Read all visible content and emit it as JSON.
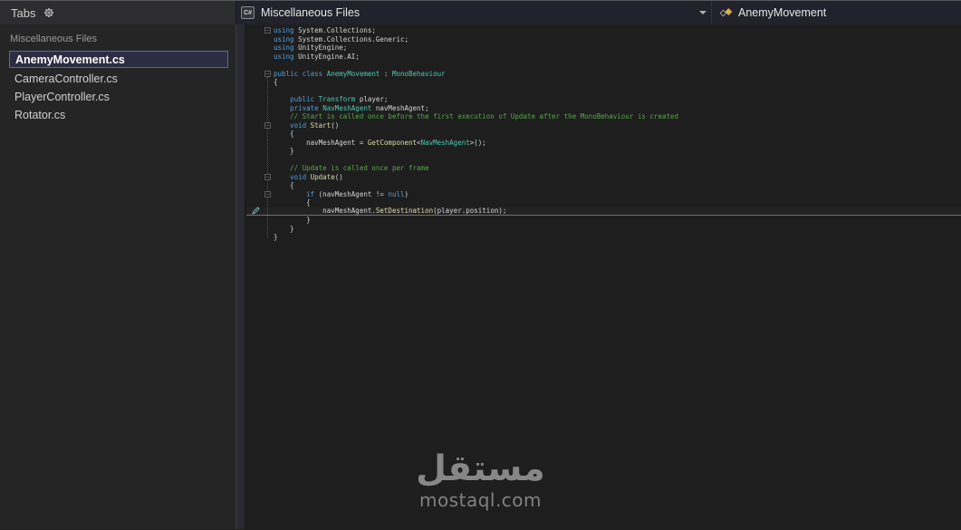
{
  "panel": {
    "title": "Tabs"
  },
  "sidebar": {
    "group_label": "Miscellaneous Files",
    "items": [
      {
        "label": "AnemyMovement.cs",
        "selected": true
      },
      {
        "label": "CameraController.cs",
        "selected": false
      },
      {
        "label": "PlayerController.cs",
        "selected": false
      },
      {
        "label": "Rotator.cs",
        "selected": false
      }
    ]
  },
  "editor_bar": {
    "file_icon_label": "C#",
    "project_label": "Miscellaneous Files",
    "symbol_label": "AnemyMovement"
  },
  "editor": {
    "current_line_index": 21,
    "lines": [
      {
        "fold": true,
        "tokens": [
          {
            "c": "kw",
            "t": "using"
          },
          {
            "c": "pl",
            "t": " System.Collections;"
          }
        ]
      },
      {
        "fold": false,
        "tokens": [
          {
            "c": "kw",
            "t": "using"
          },
          {
            "c": "pl",
            "t": " System.Collections.Generic;"
          }
        ]
      },
      {
        "fold": false,
        "tokens": [
          {
            "c": "kw",
            "t": "using"
          },
          {
            "c": "pl",
            "t": " UnityEngine;"
          }
        ]
      },
      {
        "fold": false,
        "tokens": [
          {
            "c": "kw",
            "t": "using"
          },
          {
            "c": "pl",
            "t": " UnityEngine.AI;"
          }
        ]
      },
      {
        "fold": false,
        "tokens": []
      },
      {
        "fold": true,
        "tokens": [
          {
            "c": "kw",
            "t": "public"
          },
          {
            "c": "pl",
            "t": " "
          },
          {
            "c": "kw",
            "t": "class"
          },
          {
            "c": "pl",
            "t": " "
          },
          {
            "c": "ty",
            "t": "AnemyMovement"
          },
          {
            "c": "pl",
            "t": " : "
          },
          {
            "c": "ty",
            "t": "MonoBehaviour"
          }
        ]
      },
      {
        "fold": false,
        "tokens": [
          {
            "c": "pl",
            "t": "{"
          }
        ]
      },
      {
        "fold": false,
        "tokens": []
      },
      {
        "fold": false,
        "tokens": [
          {
            "c": "pl",
            "t": "    "
          },
          {
            "c": "kw",
            "t": "public"
          },
          {
            "c": "pl",
            "t": " "
          },
          {
            "c": "ty",
            "t": "Transform"
          },
          {
            "c": "pl",
            "t": " player;"
          }
        ]
      },
      {
        "fold": false,
        "tokens": [
          {
            "c": "pl",
            "t": "    "
          },
          {
            "c": "kw",
            "t": "private"
          },
          {
            "c": "pl",
            "t": " "
          },
          {
            "c": "ty",
            "t": "NavMeshAgent"
          },
          {
            "c": "pl",
            "t": " navMeshAgent;"
          }
        ]
      },
      {
        "fold": false,
        "tokens": [
          {
            "c": "co",
            "t": "    // Start is called once before the first execution of Update after the MonoBehaviour is created"
          }
        ]
      },
      {
        "fold": true,
        "tokens": [
          {
            "c": "pl",
            "t": "    "
          },
          {
            "c": "kw",
            "t": "void"
          },
          {
            "c": "pl",
            "t": " "
          },
          {
            "c": "me",
            "t": "Start"
          },
          {
            "c": "pl",
            "t": "()"
          }
        ]
      },
      {
        "fold": false,
        "tokens": [
          {
            "c": "pl",
            "t": "    {"
          }
        ]
      },
      {
        "fold": false,
        "tokens": [
          {
            "c": "pl",
            "t": "        navMeshAgent = "
          },
          {
            "c": "me",
            "t": "GetComponent"
          },
          {
            "c": "pl",
            "t": "<"
          },
          {
            "c": "ty",
            "t": "NavMeshAgent"
          },
          {
            "c": "pl",
            "t": ">();"
          }
        ]
      },
      {
        "fold": false,
        "tokens": [
          {
            "c": "pl",
            "t": "    }"
          }
        ]
      },
      {
        "fold": false,
        "tokens": []
      },
      {
        "fold": false,
        "tokens": [
          {
            "c": "co",
            "t": "    // Update is called once per frame"
          }
        ]
      },
      {
        "fold": true,
        "tokens": [
          {
            "c": "pl",
            "t": "    "
          },
          {
            "c": "kw",
            "t": "void"
          },
          {
            "c": "pl",
            "t": " "
          },
          {
            "c": "me",
            "t": "Update"
          },
          {
            "c": "pl",
            "t": "()"
          }
        ]
      },
      {
        "fold": false,
        "tokens": [
          {
            "c": "pl",
            "t": "    {"
          }
        ]
      },
      {
        "fold": true,
        "tokens": [
          {
            "c": "pl",
            "t": "        "
          },
          {
            "c": "kw",
            "t": "if"
          },
          {
            "c": "pl",
            "t": " (navMeshAgent != "
          },
          {
            "c": "kw",
            "t": "null"
          },
          {
            "c": "pl",
            "t": ")"
          }
        ]
      },
      {
        "fold": false,
        "tokens": [
          {
            "c": "pl",
            "t": "        {"
          }
        ]
      },
      {
        "fold": false,
        "tokens": [
          {
            "c": "pl",
            "t": "            navMeshAgent."
          },
          {
            "c": "me",
            "t": "SetDestination"
          },
          {
            "c": "pl",
            "t": "(player.position);"
          }
        ]
      },
      {
        "fold": false,
        "tokens": [
          {
            "c": "pl",
            "t": "        }"
          }
        ]
      },
      {
        "fold": false,
        "tokens": [
          {
            "c": "pl",
            "t": "    }"
          }
        ]
      },
      {
        "fold": false,
        "tokens": [
          {
            "c": "pl",
            "t": "}"
          }
        ]
      }
    ]
  },
  "watermark": {
    "arabic": "مستقل",
    "domain": "mostaql.com"
  },
  "colors": {
    "keyword": "#569cd6",
    "type": "#4ec9b0",
    "method": "#dcdcaa",
    "comment": "#57a64a",
    "plain": "#d4d4d4",
    "selection_border": "#4f6bac",
    "panel_bg": "#252526",
    "editor_bg": "#1e1e1e"
  }
}
